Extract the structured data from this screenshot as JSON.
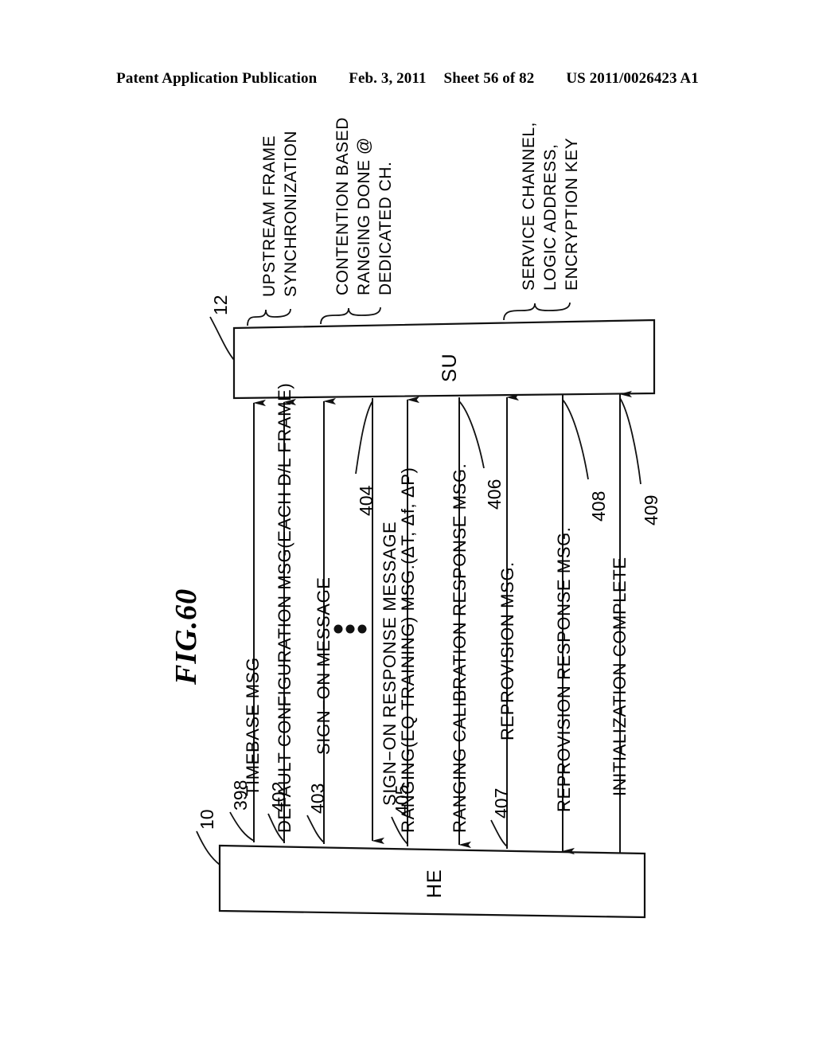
{
  "header": {
    "publication": "Patent Application Publication",
    "date": "Feb. 3, 2011",
    "sheet": "Sheet 56 of 82",
    "patent_number": "US 2011/0026423 A1"
  },
  "figure": {
    "label": "FIG.60",
    "nodes": {
      "su": {
        "label": "SU",
        "ref": "12"
      },
      "he": {
        "label": "HE",
        "ref": "10"
      }
    },
    "ellipsis": "•••",
    "messages": [
      {
        "ref": "398",
        "label": "TIMEBASE MSG",
        "direction": "he-to-su"
      },
      {
        "ref": "402",
        "label": "DEFAULT CONFIGURATION MSG(EACH D/L FRAME)",
        "direction": "he-to-su"
      },
      {
        "ref": "403",
        "label": "SIGN−ON MESSAGE",
        "direction": "he-to-su"
      },
      {
        "ref": "404",
        "label": "SIGN−ON RESPONSE MESSAGE",
        "direction": "su-to-he"
      },
      {
        "ref": "405",
        "label": "RANGING(EQ TRAINING) MSG.(ΔT, Δf, ΔP)",
        "direction": "he-to-su"
      },
      {
        "ref": "406",
        "label": "RANGING CALIBRATION RESPONSE MSG.",
        "direction": "su-to-he"
      },
      {
        "ref": "407",
        "label": "REPROVISION MSG.",
        "direction": "he-to-su"
      },
      {
        "ref": "408",
        "label": "REPROVISION RESPONSE MSG.",
        "direction": "su-to-he"
      },
      {
        "ref": "409",
        "label": "INITIALIZATION COMPLETE",
        "direction": "he-to-su"
      }
    ],
    "brace_groups": [
      {
        "lines": [
          "UPSTREAM FRAME",
          "SYNCHRONIZATION"
        ]
      },
      {
        "lines": [
          "CONTENTION BASED",
          "RANGING DONE @",
          "DEDICATED CH."
        ]
      },
      {
        "lines": [
          "SERVICE CHANNEL,",
          "LOGIC ADDRESS,",
          "ENCRYPTION KEY"
        ]
      }
    ]
  }
}
